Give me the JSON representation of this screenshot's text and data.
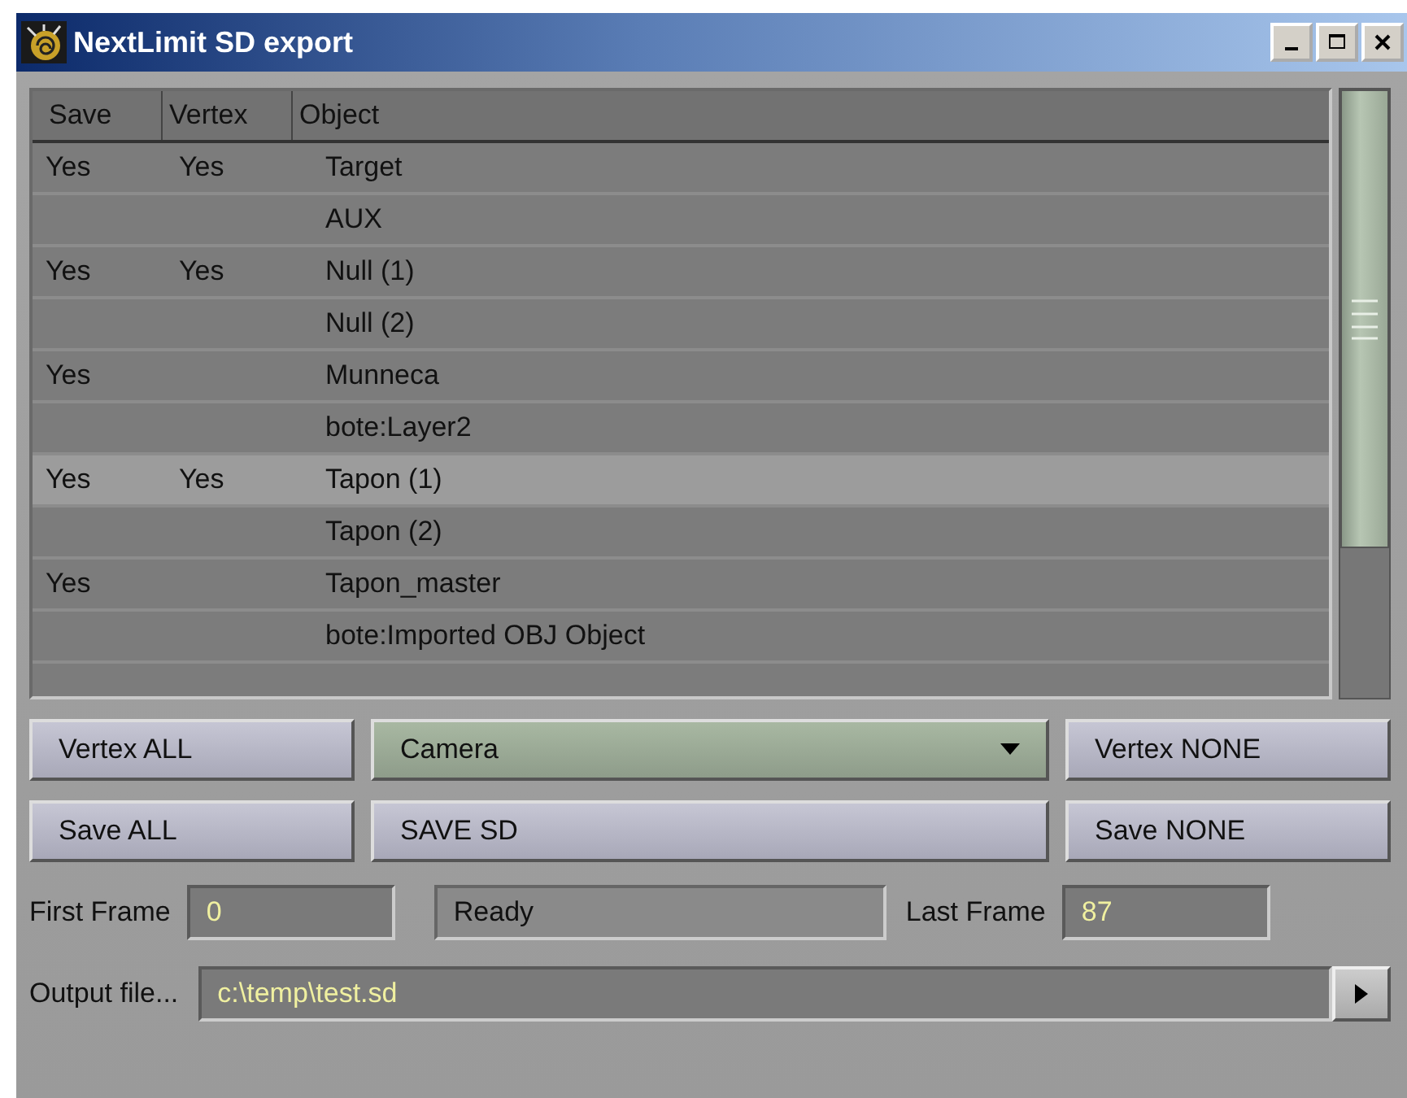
{
  "window": {
    "title": "NextLimit SD export"
  },
  "table": {
    "columns": [
      "Save",
      "Vertex",
      "Object"
    ],
    "rows": [
      {
        "save": "Yes",
        "vertex": "Yes",
        "object": "Target",
        "selected": false
      },
      {
        "object": "AUX",
        "selected": false
      },
      {
        "save": "Yes",
        "vertex": "Yes",
        "object": "Null (1)",
        "selected": false
      },
      {
        "object": "Null (2)",
        "selected": false
      },
      {
        "save": "Yes",
        "object": "Munneca",
        "selected": false
      },
      {
        "object": "bote:Layer2",
        "selected": false
      },
      {
        "save": "Yes",
        "vertex": "Yes",
        "object": "Tapon (1)",
        "selected": true
      },
      {
        "object": "Tapon (2)",
        "selected": false
      },
      {
        "save": "Yes",
        "object": "Tapon_master",
        "selected": false
      },
      {
        "object": "bote:Imported OBJ Object",
        "selected": false
      }
    ]
  },
  "controls": {
    "vertex_all": "Vertex ALL",
    "camera": "Camera",
    "vertex_none": "Vertex NONE",
    "save_all": "Save ALL",
    "save_sd": "SAVE SD",
    "save_none": "Save NONE"
  },
  "frames": {
    "first_label": "First Frame",
    "first_value": "0",
    "status": "Ready",
    "last_label": "Last Frame",
    "last_value": "87"
  },
  "output": {
    "label": "Output file...",
    "value": "c:\\temp\\test.sd"
  }
}
